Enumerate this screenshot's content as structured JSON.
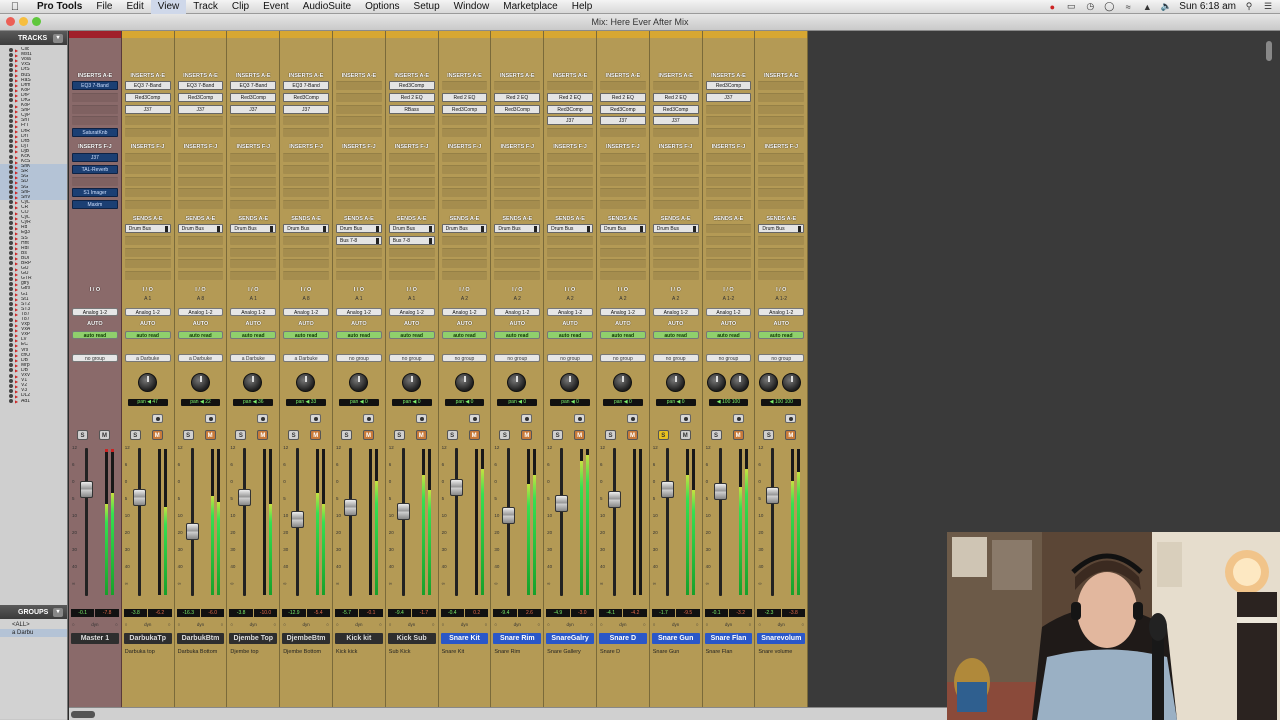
{
  "menubar": {
    "app": "Pro Tools",
    "items": [
      "File",
      "Edit",
      "View",
      "Track",
      "Clip",
      "Event",
      "AudioSuite",
      "Options",
      "Setup",
      "Window",
      "Marketplace",
      "Help"
    ],
    "clock": "Sun 6:18 am"
  },
  "window": {
    "title": "Mix: Here Ever After Mix"
  },
  "tracks_panel": {
    "header": "TRACKS",
    "items": [
      "Clic",
      "Mst1",
      "Vola",
      "VxS",
      "DrS",
      "BuS",
      "RaS",
      "Drm",
      "KoP",
      "DrP",
      "DrG",
      "KoP",
      "SnP",
      "CyP",
      "ShT",
      "FrT",
      "DrR",
      "DrT",
      "DrB",
      "DjT",
      "DjB",
      "KcK",
      "KcS",
      "SnK",
      "SR",
      "SG",
      "SD",
      "SG",
      "SnF",
      "SnV",
      "CyL",
      "CR",
      "CO",
      "CyL",
      "CyR",
      "Rd",
      "Eg3",
      "SS",
      "Hht",
      "RdI",
      "Bs",
      "BDI",
      "BRP",
      "GU",
      "GU",
      "GTR",
      "gtry",
      "Gtrs",
      "G1",
      "St1",
      "ST2",
      "ST3",
      "T87",
      "T87",
      "Vxp",
      "VxA",
      "VxP",
      "LV",
      "EC",
      "Vrs",
      "chO",
      "DB",
      "Mrp",
      "DB",
      "VxV",
      "V1",
      "V2",
      "V3",
      "DL2",
      "Ad1"
    ]
  },
  "groups_panel": {
    "header": "GROUPS",
    "items": [
      "<ALL>",
      "a Darbu"
    ]
  },
  "strips": [
    {
      "name": "Master 1",
      "comment": "",
      "master": true,
      "inserts_ae": [
        "EQ3 7-Band",
        "",
        "",
        "",
        "SaturatKnb"
      ],
      "inserts_ae_blue": true,
      "inserts_fj": [
        "J37",
        "TAL-Reverb",
        "",
        "S1 Imager",
        "Maxim"
      ],
      "inserts_fj_blue": true,
      "sends": [],
      "io_sub": "",
      "input": "",
      "output": "Analog 1-2",
      "auto": "AUTO",
      "auto_mode": "auto read",
      "group": "no group",
      "pan": [],
      "vol": "-0.1",
      "peak": "-7.8",
      "knob_count": 0,
      "solo": false,
      "mute": false
    },
    {
      "name": "DarbukaTp",
      "comment": "Darbuka top",
      "inserts_ae": [
        "EQ3 7-Band",
        "Red3Comp",
        "J37"
      ],
      "inserts_fj": [],
      "sends": [
        "Drum Bus"
      ],
      "io_sub": "A 1",
      "output": "Analog 1-2",
      "auto": "AUTO",
      "auto_mode": "auto read",
      "group": "a Darbuke",
      "pan": [
        "pan",
        "47"
      ],
      "vol": "-3.8",
      "peak": "-6.2",
      "knob_count": 1,
      "solo": false,
      "mute": true
    },
    {
      "name": "DarbukBtm",
      "comment": "Darbuka Bottom",
      "inserts_ae": [
        "EQ3 7-Band",
        "Red3Comp",
        "J37"
      ],
      "inserts_fj": [],
      "sends": [
        "Drum Bus"
      ],
      "io_sub": "A 8",
      "output": "Analog 1-2",
      "auto": "AUTO",
      "auto_mode": "auto read",
      "group": "a Darbuke",
      "pan": [
        "pan",
        "22"
      ],
      "vol": "-16.3",
      "peak": "-6.0",
      "knob_count": 1,
      "solo": false,
      "mute": true
    },
    {
      "name": "Djembe Top",
      "comment": "Djembe top",
      "inserts_ae": [
        "EQ3 7-Band",
        "Red3Comp",
        "J37"
      ],
      "inserts_fj": [],
      "sends": [
        "Drum Bus"
      ],
      "io_sub": "A 1",
      "output": "Analog 1-2",
      "auto": "AUTO",
      "auto_mode": "auto read",
      "group": "a Darbuke",
      "pan": [
        "pan",
        "36"
      ],
      "vol": "-3.8",
      "peak": "-10.0",
      "knob_count": 1,
      "solo": false,
      "mute": true
    },
    {
      "name": "DjembeBtm",
      "comment": "Djembe Bottom",
      "inserts_ae": [
        "EQ3 7-Band",
        "Red3Comp",
        "J37"
      ],
      "inserts_fj": [],
      "sends": [
        "Drum Bus"
      ],
      "io_sub": "A 8",
      "output": "Analog 1-2",
      "auto": "AUTO",
      "auto_mode": "auto read",
      "group": "a Darbuke",
      "pan": [
        "pan",
        "33"
      ],
      "vol": "-12.9",
      "peak": "-5.4",
      "knob_count": 1,
      "solo": false,
      "mute": true
    },
    {
      "name": "Kick kit",
      "comment": "Kick kick",
      "inserts_ae": [],
      "inserts_fj": [],
      "sends": [
        "Drum Bus",
        "Bus 7-8"
      ],
      "io_sub": "A 1",
      "output": "Analog 1-2",
      "auto": "AUTO",
      "auto_mode": "auto read",
      "group": "no group",
      "pan": [
        "pan",
        "0"
      ],
      "vol": "-5.7",
      "peak": "-0.1",
      "knob_count": 1,
      "solo": false,
      "mute": true
    },
    {
      "name": "Kick Sub",
      "comment": "Sub Kick",
      "inserts_ae": [
        "Red3Comp",
        "Red 2 EQ",
        "RBass"
      ],
      "inserts_fj": [],
      "sends": [
        "Drum Bus",
        "Bus 7-8"
      ],
      "io_sub": "A 1",
      "output": "Analog 1-2",
      "auto": "AUTO",
      "auto_mode": "auto read",
      "group": "no group",
      "pan": [
        "pan",
        "0"
      ],
      "vol": "-9.4",
      "peak": "-1.7",
      "knob_count": 1,
      "solo": false,
      "mute": true
    },
    {
      "name": "Snare Kit",
      "comment": "Snare Kit",
      "selected": true,
      "inserts_ae": [
        "",
        "Red 2 EQ",
        "Red3Comp"
      ],
      "inserts_fj": [],
      "sends": [
        "Drum Bus"
      ],
      "io_sub": "A 2",
      "output": "Analog 1-2",
      "auto": "AUTO",
      "auto_mode": "auto read",
      "group": "no group",
      "pan": [
        "pan",
        "0"
      ],
      "vol": "-0.4",
      "peak": "0.2",
      "knob_count": 1,
      "solo": false,
      "mute": true
    },
    {
      "name": "Snare Rim",
      "comment": "Snare Rim",
      "selected": true,
      "inserts_ae": [
        "",
        "Red 2 EQ",
        "Red3Comp"
      ],
      "inserts_fj": [],
      "sends": [
        "Drum Bus"
      ],
      "io_sub": "A 2",
      "output": "Analog 1-2",
      "auto": "AUTO",
      "auto_mode": "auto read",
      "group": "no group",
      "pan": [
        "pan",
        "0"
      ],
      "vol": "-9.4",
      "peak": "2.6",
      "knob_count": 1,
      "solo": false,
      "mute": true
    },
    {
      "name": "SnareGalry",
      "comment": "Snare Gallery",
      "selected": true,
      "inserts_ae": [
        "",
        "Red 2 EQ",
        "Red3Comp",
        "J37"
      ],
      "inserts_fj": [],
      "sends": [
        "Drum Bus"
      ],
      "io_sub": "A 2",
      "output": "Analog 1-2",
      "auto": "AUTO",
      "auto_mode": "auto read",
      "group": "no group",
      "pan": [
        "pan",
        "0"
      ],
      "vol": "-4.9",
      "peak": "-3.0",
      "knob_count": 1,
      "solo": false,
      "mute": true
    },
    {
      "name": "Snare D",
      "comment": "Snare D",
      "selected": true,
      "inserts_ae": [
        "",
        "Red 2 EQ",
        "Red3Comp",
        "J37"
      ],
      "inserts_fj": [],
      "sends": [
        "Drum Bus"
      ],
      "io_sub": "A 2",
      "output": "Analog 1-2",
      "auto": "AUTO",
      "auto_mode": "auto read",
      "group": "no group",
      "pan": [
        "pan",
        "0"
      ],
      "vol": "-4.1",
      "peak": "-4.2",
      "knob_count": 1,
      "solo": false,
      "mute": true
    },
    {
      "name": "Snare Gun",
      "comment": "Snare Gun",
      "selected": true,
      "inserts_ae": [
        "",
        "Red 2 EQ",
        "Red3Comp",
        "J37"
      ],
      "inserts_fj": [],
      "sends": [
        "Drum Bus"
      ],
      "io_sub": "A 2",
      "output": "Analog 1-2",
      "auto": "AUTO",
      "auto_mode": "auto read",
      "group": "no group",
      "pan": [
        "pan",
        "0"
      ],
      "vol": "-1.7",
      "peak": "-9.5",
      "knob_count": 1,
      "solo": true,
      "mute": false
    },
    {
      "name": "Snare Flan",
      "comment": "Snare Flan",
      "selected": true,
      "inserts_ae": [
        "Red3Comp",
        "J37"
      ],
      "inserts_fj": [],
      "sends": [],
      "io_sub": "A 1-2",
      "output": "Analog 1-2",
      "auto": "AUTO",
      "auto_mode": "auto read",
      "group": "no group",
      "pan": [
        "100",
        "100"
      ],
      "vol": "-0.1",
      "peak": "-3.2",
      "knob_count": 2,
      "solo": false,
      "mute": true
    },
    {
      "name": "Snarevolum",
      "comment": "Snare volume",
      "selected": true,
      "inserts_ae": [],
      "inserts_fj": [],
      "sends": [
        "Drum Bus"
      ],
      "io_sub": "A 1-2",
      "output": "Analog 1-2",
      "auto": "AUTO",
      "auto_mode": "auto read",
      "group": "no group",
      "pan": [
        "100",
        "100"
      ],
      "vol": "-2.3",
      "peak": "-3.8",
      "knob_count": 2,
      "solo": false,
      "mute": true
    }
  ],
  "labels": {
    "inserts_ae": "INSERTS A-E",
    "inserts_fj": "INSERTS F-J",
    "sends_ae": "SENDS A-E",
    "io": "I / O",
    "solo": "S",
    "mute": "M",
    "dyn": "dyn"
  }
}
